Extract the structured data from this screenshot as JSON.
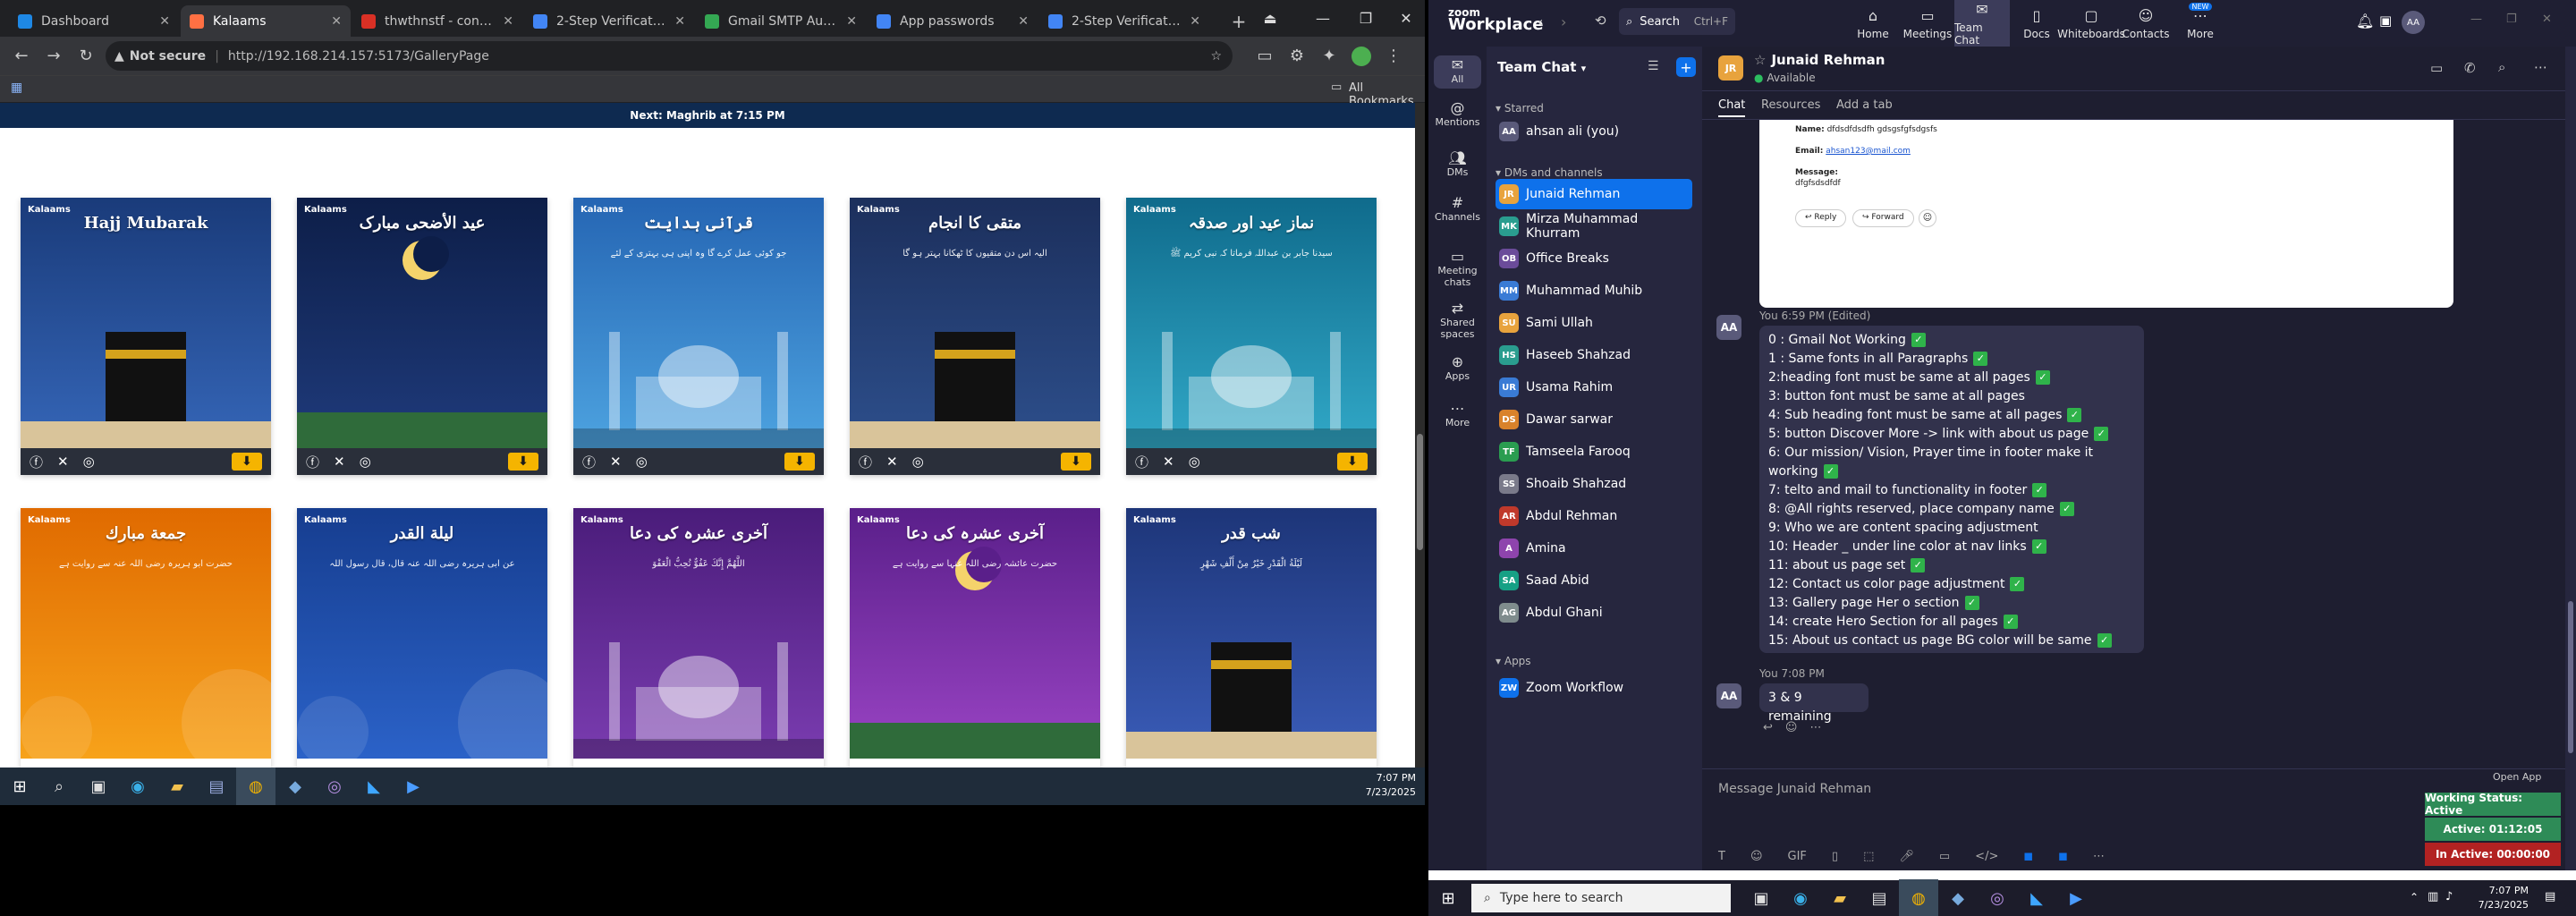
{
  "left_monitor": {
    "tabs": [
      {
        "title": "Dashboard",
        "favicon_color": "#1e88e5"
      },
      {
        "title": "Kalaams",
        "favicon_color": "#ff7043"
      },
      {
        "title": "thwthnstf - contania",
        "favicon_color": "#d93025"
      },
      {
        "title": "2-Step Verification",
        "favicon_color": "#4285f4"
      },
      {
        "title": "Gmail SMTP Authentic",
        "favicon_color": "#34a853"
      },
      {
        "title": "App passwords",
        "favicon_color": "#4285f4"
      },
      {
        "title": "2-Step Verification",
        "favicon_color": "#4285f4"
      }
    ],
    "active_tab_index": 1,
    "address": {
      "security": "Not secure",
      "url": "http://192.168.214.157:5173/GalleryPage"
    },
    "bookmarks_label": "All Bookmarks",
    "prayer_bar": "Next: Maghrib at 7:15 PM",
    "cards": [
      {
        "title": "Hajj Mubarak",
        "logo": "Kalaams",
        "bg": [
          "#1a3b7a",
          "#3566b8"
        ],
        "theme": "kaaba",
        "body": ""
      },
      {
        "title": "عید الأضحی مبارک",
        "logo": "Kalaams",
        "bg": [
          "#0d1e48",
          "#1f3b7c"
        ],
        "theme": "moon",
        "body": ""
      },
      {
        "title": "قرآنی ہدایت",
        "logo": "Kalaams",
        "bg": [
          "#2565b3",
          "#4da3e0"
        ],
        "theme": "mosque",
        "body": "جو کوئی عمل کرے گا وہ اپنی ہی بہتری کے لئے"
      },
      {
        "title": "متقی کا انجام",
        "logo": "Kalaams",
        "bg": [
          "#1c2f5c",
          "#2d4f8c"
        ],
        "theme": "kaaba",
        "body": "الیہ اس دن متقیوں کا ٹھکانا بہتر ہو گا"
      },
      {
        "title": "نماز عید اور صدقہ",
        "logo": "Kalaams",
        "bg": [
          "#0f6b8c",
          "#31a8c7"
        ],
        "theme": "mosque",
        "body": "سیدنا جابر بن عبداللہ فرماتا کہ نبی کریم ﷺ"
      },
      {
        "title": "جمعة مبارك",
        "logo": "Kalaams",
        "bg": [
          "#e06a00",
          "#f7a21a"
        ],
        "theme": "plain",
        "body": "حضرت ابو ہریرہ رضی اللہ عنہ سے روایت ہے"
      },
      {
        "title": "ليلة القدر",
        "logo": "Kalaams",
        "bg": [
          "#163d8f",
          "#2b62c8"
        ],
        "theme": "plain",
        "body": "عن ابی ہریرہ رضی اللہ عنہ قال، قال رسول اللہ"
      },
      {
        "title": "آخری عشرہ کی دعا",
        "logo": "Kalaams",
        "bg": [
          "#4a1c7a",
          "#7a3cb0"
        ],
        "theme": "mosque",
        "body": "اللَّهُمَّ إِنَّكَ عَفُوٌّ تُحِبُّ الْعَفْوَ"
      },
      {
        "title": "آخری عشرہ کی دعا",
        "logo": "Kalaams",
        "bg": [
          "#5a1f8a",
          "#9a44c4"
        ],
        "theme": "moon",
        "body": "حضرت عائشہ رضی اللہ عنہا سے روایت ہے"
      },
      {
        "title": "شب قدر",
        "logo": "Kalaams",
        "bg": [
          "#1d3578",
          "#3a5cb8"
        ],
        "theme": "kaaba",
        "body": "لَيْلَةُ الْقَدْرِ خَيْرٌ مِنْ أَلْفِ شَهْرٍ"
      }
    ],
    "taskbar_time": "7:07 PM",
    "taskbar_date": "7/23/2025"
  },
  "zoom": {
    "brand_top": "zoom",
    "brand_bottom": "Workplace",
    "search_label": "Search",
    "search_shortcut": "Ctrl+F",
    "top_tabs": [
      {
        "label": "Home",
        "icon": "home-icon"
      },
      {
        "label": "Meetings",
        "icon": "video-icon"
      },
      {
        "label": "Team Chat",
        "icon": "chat-icon"
      },
      {
        "label": "Docs",
        "icon": "doc-icon"
      },
      {
        "label": "Whiteboards",
        "icon": "whiteboard-icon"
      },
      {
        "label": "Contacts",
        "icon": "contacts-icon"
      },
      {
        "label": "More",
        "icon": "more-icon"
      }
    ],
    "active_top_tab_index": 2,
    "new_badge": "NEW",
    "rail": [
      {
        "label": "All",
        "icon": "chat-icon"
      },
      {
        "label": "Mentions",
        "icon": "at-icon"
      },
      {
        "label": "DMs",
        "icon": "people-icon"
      },
      {
        "label": "Channels",
        "icon": "hash-icon"
      },
      {
        "label": "Meeting chats",
        "icon": "video-icon"
      },
      {
        "label": "Shared spaces",
        "icon": "shared-icon"
      },
      {
        "label": "Apps",
        "icon": "apps-icon"
      },
      {
        "label": "More",
        "icon": "more-icon"
      }
    ],
    "sidebar_title": "Team Chat",
    "sections": {
      "starred": "Starred",
      "dms": "DMs and channels",
      "apps": "Apps"
    },
    "starred": [
      {
        "name": "ahsan ali (you)",
        "initials": "AA",
        "color": "#5a5a7a"
      }
    ],
    "dms": [
      {
        "name": "Junaid Rehman",
        "initials": "JR",
        "color": "#e8a33d"
      },
      {
        "name": "Mirza Muhammad Khurram",
        "initials": "MK",
        "color": "#2a9d8f"
      },
      {
        "name": "Office Breaks",
        "initials": "OB",
        "color": "#6b4c9a"
      },
      {
        "name": "Muhammad Muhib",
        "initials": "MM",
        "color": "#3a7bd5"
      },
      {
        "name": "Sami Ullah",
        "initials": "SU",
        "color": "#e8a33d"
      },
      {
        "name": "Haseeb Shahzad",
        "initials": "HS",
        "color": "#2a9d8f"
      },
      {
        "name": "Usama Rahim",
        "initials": "UR",
        "color": "#3a7bd5"
      },
      {
        "name": "Dawar sarwar",
        "initials": "DS",
        "color": "#d9822b"
      },
      {
        "name": "Tamseela Farooq",
        "initials": "TF",
        "color": "#2a9d50"
      },
      {
        "name": "Shoaib Shahzad",
        "initials": "SS",
        "color": "#7a7a8a"
      },
      {
        "name": "Abdul Rehman",
        "initials": "AR",
        "color": "#c0392b"
      },
      {
        "name": "Amina",
        "initials": "A",
        "color": "#8e44ad"
      },
      {
        "name": "Saad Abid",
        "initials": "SA",
        "color": "#16a085"
      },
      {
        "name": "Abdul Ghani",
        "initials": "AG",
        "color": "#7f8c8d"
      }
    ],
    "apps": [
      {
        "name": "Zoom Workflow",
        "initials": "ZW",
        "color": "#0e71eb"
      }
    ],
    "chat": {
      "name": "Junaid Rehman",
      "status": "Available",
      "tabs": [
        "Chat",
        "Resources",
        "Add a tab"
      ],
      "email_card": {
        "name_label": "Name:",
        "name_value": "dfdsdfdsdfh gdsgsfgfsdgsfs",
        "email_label": "Email:",
        "email_value": "ahsan123@mail.com",
        "message_label": "Message:",
        "message_value": "dfgfsdsdfdf",
        "reply": "Reply",
        "forward": "Forward"
      },
      "msg1_meta": "You 6:59 PM (Edited)",
      "msg1_lines": [
        {
          "text": "0 : Gmail Not Working",
          "done": true
        },
        {
          "text": "1 : Same fonts in all Paragraphs",
          "done": true
        },
        {
          "text": "2:heading font must be same at all pages",
          "done": true
        },
        {
          "text": "3: button font must be same at all pages",
          "done": false
        },
        {
          "text": "4: Sub heading font must be same at all pages",
          "done": true
        },
        {
          "text": "5: button Discover More -> link with about us page",
          "done": true
        },
        {
          "text": "6: Our mission/ Vision, Prayer time in footer make it working",
          "done": true
        },
        {
          "text": "7: telto and mail to functionality in footer",
          "done": true
        },
        {
          "text": "8: @All rights reserved, place company name",
          "done": true
        },
        {
          "text": "9: Who we are content spacing adjustment",
          "done": false
        },
        {
          "text": "10: Header _ under line color at nav links",
          "done": true
        },
        {
          "text": "11: about us page set",
          "done": true
        },
        {
          "text": "12: Contact us color page adjustment",
          "done": true
        },
        {
          "text": "13: Gallery page Her o section",
          "done": true
        },
        {
          "text": "14: create Hero Section for all pages",
          "done": true
        },
        {
          "text": "15: About us contact us page BG color will be same",
          "done": true
        }
      ],
      "msg2_meta": "You 7:08 PM",
      "msg2_text": "3 & 9 remaining",
      "avatar_initials": "AA",
      "composer_placeholder": "Message Junaid Rehman",
      "check_mark": "✓"
    },
    "open_app": "Open App",
    "working_status": [
      {
        "label": "Working Status: Active",
        "bg": "#2e8b57",
        "fg": "#ffffff"
      },
      {
        "label": "Active: 01:12:05",
        "bg": "#2e8b57",
        "fg": "#ffffff"
      },
      {
        "label": "In Active: 00:00:00",
        "bg": "#b22222",
        "fg": "#ffffff"
      }
    ],
    "taskbar_search": "Type here to search",
    "taskbar_time": "7:07 PM",
    "taskbar_date": "7/23/2025"
  }
}
